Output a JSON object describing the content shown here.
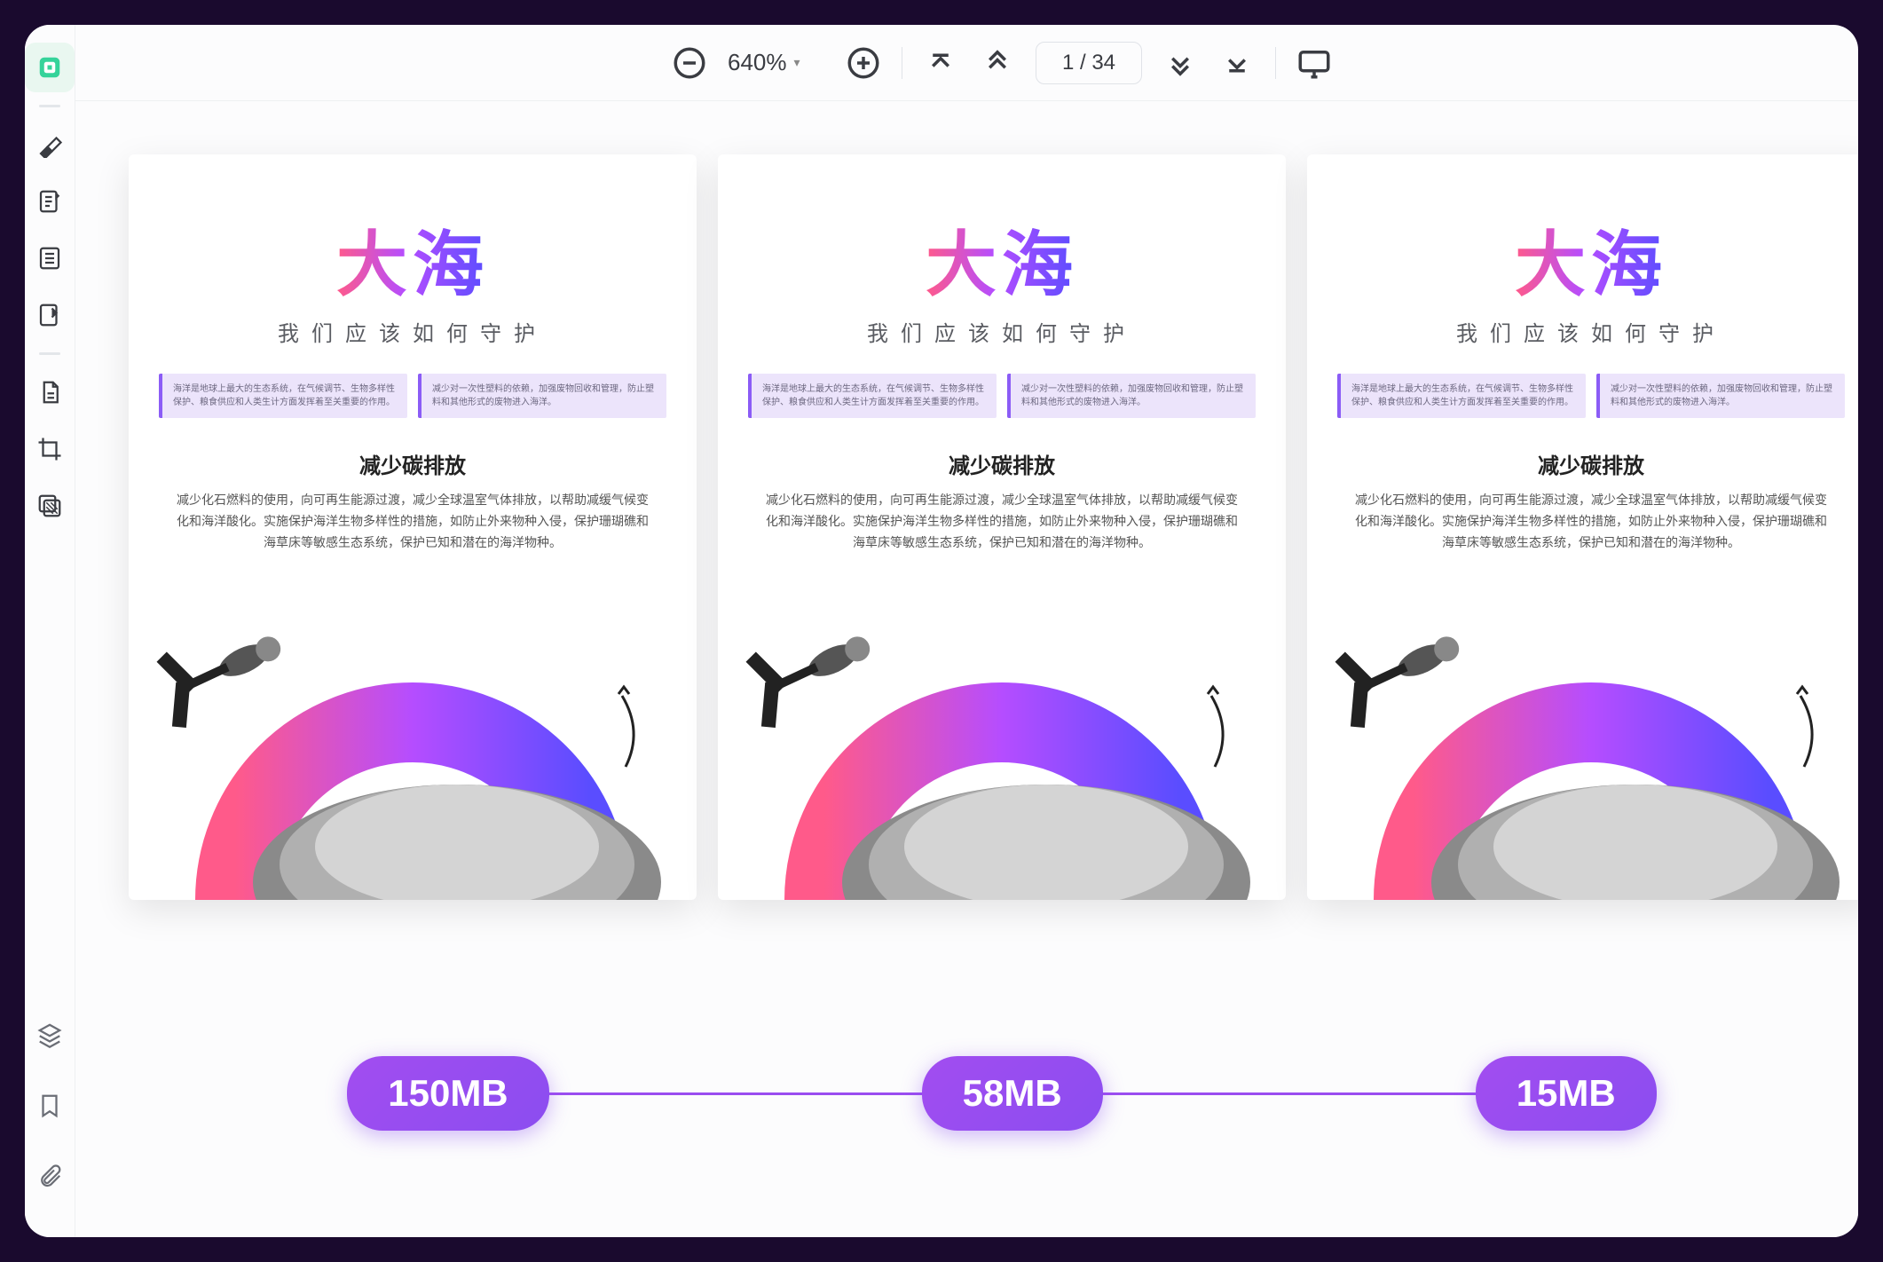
{
  "toolbar": {
    "zoom": "640%",
    "page_indicator": "1 / 34"
  },
  "document": {
    "title": "大海",
    "subtitle": "我们应该如何守护",
    "info_box_left": "海洋是地球上最大的生态系统，在气候调节、生物多样性保护、粮食供应和人类生计方面发挥着至关重要的作用。",
    "info_box_right": "减少对一次性塑料的依赖，加强废物回收和管理，防止塑料和其他形式的废物进入海洋。",
    "section_heading": "减少碳排放",
    "section_body": "减少化石燃料的使用，向可再生能源过渡，减少全球温室气体排放，以帮助减缓气候变化和海洋酸化。实施保护海洋生物多样性的措施，如防止外来物种入侵，保护珊瑚礁和海草床等敏感生态系统，保护已知和潜在的海洋物种。"
  },
  "sizes": [
    "150MB",
    "58MB",
    "15MB"
  ],
  "sidebar": {
    "items": [
      "reader",
      "highlighter",
      "annotate",
      "outline",
      "crop",
      "doc",
      "copy",
      "frame",
      "pattern"
    ],
    "bottom": [
      "layers",
      "bookmark",
      "attach"
    ]
  }
}
